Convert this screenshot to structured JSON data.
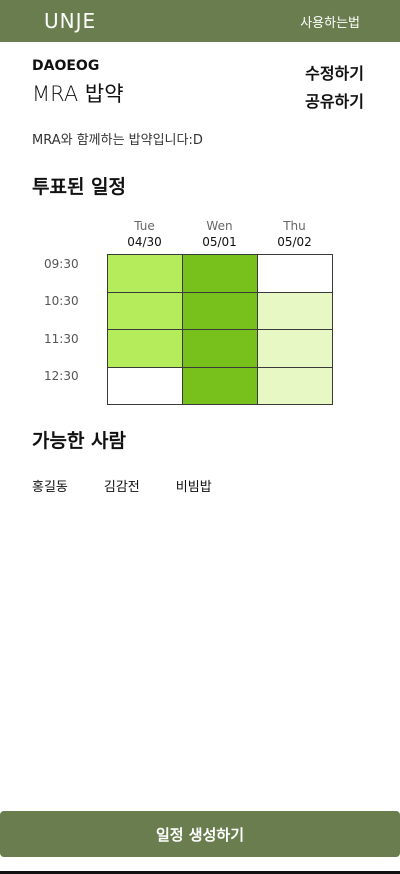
{
  "header": {
    "logo": "UNJE",
    "howto_label": "사용하는법"
  },
  "meeting": {
    "group": "DAOEOG",
    "title": "MRA 밥약",
    "description": "MRA와 함께하는 밥약입니다:D"
  },
  "actions": {
    "edit_label": "수정하기",
    "share_label": "공유하기"
  },
  "sections": {
    "voted_title": "투표된 일정",
    "available_title": "가능한 사람"
  },
  "schedule": {
    "days": [
      {
        "dow": "Tue",
        "date": "04/30"
      },
      {
        "dow": "Wen",
        "date": "05/01"
      },
      {
        "dow": "Thu",
        "date": "05/02"
      }
    ],
    "times": [
      "09:30",
      "10:30",
      "11:30",
      "12:30"
    ],
    "levels": [
      [
        0.6,
        1.0,
        0.0
      ],
      [
        0.6,
        1.0,
        0.2
      ],
      [
        0.6,
        1.0,
        0.2
      ],
      [
        0.0,
        1.0,
        0.2
      ]
    ],
    "colors": {
      "empty": "#ffffff",
      "low": "#e8f8c4",
      "mid": "#b4ec5c",
      "high": "#78c01c"
    }
  },
  "people": [
    "홍길동",
    "김감전",
    "비빔밥"
  ],
  "cta": {
    "label": "일정 생성하기"
  },
  "theme": {
    "primary": "#6a7d4f"
  }
}
